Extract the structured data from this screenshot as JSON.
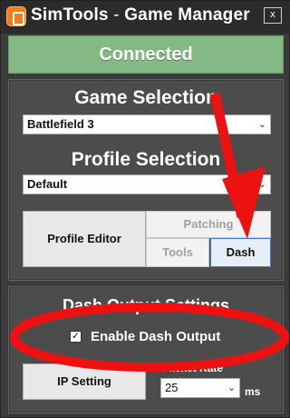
{
  "window": {
    "title_part1": "SimTools",
    "title_sep": " - ",
    "title_part2": "Game",
    "title_part3": " Manager",
    "close_label": "x"
  },
  "status": {
    "text": "Connected",
    "color": "#84b884"
  },
  "game_selection": {
    "heading": "Game Selection",
    "selected": "Battlefield 3"
  },
  "profile_selection": {
    "heading": "Profile Selection",
    "selected": "Default"
  },
  "buttons": {
    "profile_editor": "Profile Editor",
    "patching": "Patching",
    "tools": "Tools",
    "dash": "Dash"
  },
  "dash_output": {
    "heading": "Dash Output Settings",
    "enable_label": "Enable Dash Output",
    "enabled": true,
    "ip_setting": "IP Setting",
    "packet_rate_label": "Packet Rate",
    "packet_rate_value": "25",
    "unit": "ms"
  },
  "annotation_color": "#ee1111",
  "icons": [
    "app-icon",
    "close-icon",
    "chevron-down-icon",
    "checkmark-icon"
  ]
}
